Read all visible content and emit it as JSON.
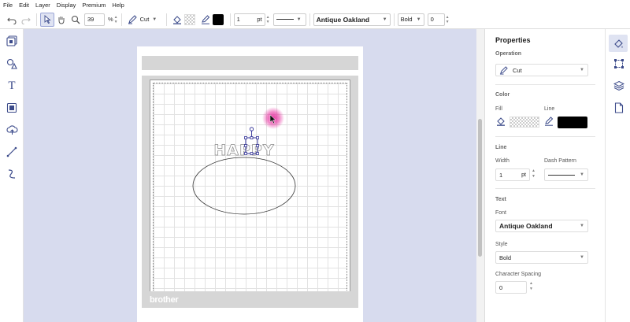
{
  "menu": [
    "File",
    "Edit",
    "Layer",
    "Display",
    "Premium",
    "Help"
  ],
  "toolbar": {
    "zoom_value": "39",
    "zoom_unit": "%",
    "operation": "Cut",
    "line_width": "1",
    "line_unit": "pt",
    "font": "Antique Oakland",
    "style": "Bold",
    "char_spacing": "0"
  },
  "canvas": {
    "text_object": "HAPPY",
    "brand": "brother"
  },
  "properties": {
    "title": "Properties",
    "operation_label": "Operation",
    "operation_value": "Cut",
    "color_label": "Color",
    "fill_label": "Fill",
    "line_label": "Line",
    "line_section_label": "Line",
    "width_label": "Width",
    "width_value": "1",
    "width_unit": "pt",
    "dash_label": "Dash Pattern",
    "text_label": "Text",
    "font_label": "Font",
    "font_value": "Antique Oakland",
    "style_label": "Style",
    "style_value": "Bold",
    "spacing_label": "Character Spacing",
    "spacing_value": "0"
  },
  "colors": {
    "accent": "#3b4a8a",
    "canvas_bg": "#d7dbee",
    "cursor_highlight": "#e5259a"
  },
  "icons": {
    "left_sidebar": [
      "templates-icon",
      "shapes-icon",
      "text-icon",
      "image-icon",
      "cloud-icon",
      "line-icon",
      "pen-icon"
    ],
    "right_rail": [
      "fill-properties-icon",
      "transform-icon",
      "layers-icon",
      "file-icon"
    ]
  }
}
